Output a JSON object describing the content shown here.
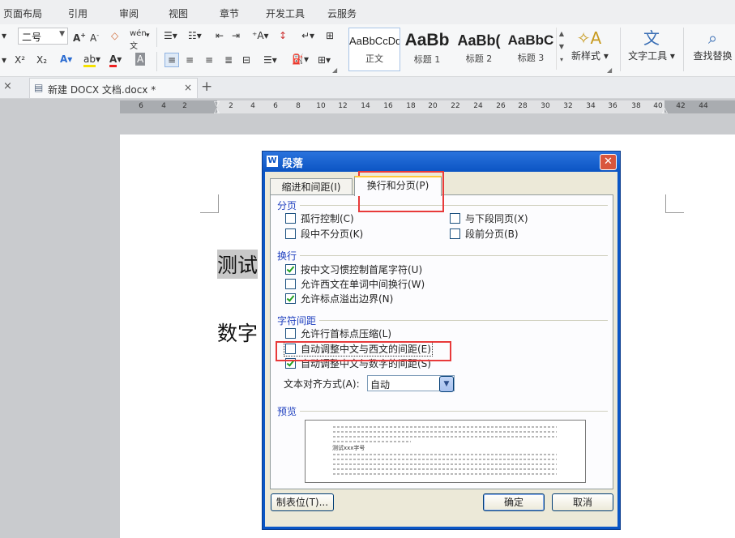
{
  "menubar": {
    "items": [
      "页面布局",
      "引用",
      "审阅",
      "视图",
      "章节",
      "开发工具",
      "云服务"
    ]
  },
  "toolbar": {
    "font_size": "二号",
    "styles": [
      {
        "preview": "AaBbCcDd",
        "name": "正文"
      },
      {
        "preview": "AaBb",
        "name": "标题 1"
      },
      {
        "preview": "AaBb(",
        "name": "标题 2"
      },
      {
        "preview": "AaBbC",
        "name": "标题 3"
      }
    ],
    "new_style_label": "新样式",
    "text_tools_label": "文字工具",
    "find_replace_label": "查找替换"
  },
  "tabbar": {
    "doc_tab_title": "新建 DOCX 文档.docx *",
    "close_symbol": "×",
    "add_symbol": "+"
  },
  "ruler": {
    "numbers": [
      "6",
      "4",
      "2",
      "2",
      "4",
      "6",
      "8",
      "10",
      "12",
      "14",
      "16",
      "18",
      "20",
      "22",
      "24",
      "26",
      "28",
      "30",
      "32",
      "34",
      "36",
      "38",
      "40",
      "42",
      "44"
    ]
  },
  "document": {
    "line1": "测试",
    "line2": "数字"
  },
  "dialog": {
    "title": "段落",
    "close_symbol": "✕",
    "tabs": [
      "缩进和间距(I)",
      "换行和分页(P)"
    ],
    "sections": {
      "pagination": "分页",
      "line_break": "换行",
      "char_spacing": "字符间距",
      "preview": "预览"
    },
    "pagination_options": [
      {
        "label": "孤行控制(C)",
        "checked": false
      },
      {
        "label": "与下段同页(X)",
        "checked": false
      },
      {
        "label": "段中不分页(K)",
        "checked": false
      },
      {
        "label": "段前分页(B)",
        "checked": false
      }
    ],
    "line_break_options": [
      {
        "label": "按中文习惯控制首尾字符(U)",
        "checked": true
      },
      {
        "label": "允许西文在单词中间换行(W)",
        "checked": false
      },
      {
        "label": "允许标点溢出边界(N)",
        "checked": true
      }
    ],
    "char_spacing_options": [
      {
        "label": "允许行首标点压缩(L)",
        "checked": false
      },
      {
        "label": "自动调整中文与西文的间距(E)",
        "checked": false
      },
      {
        "label": "自动调整中文与数字的间距(S)",
        "checked": true
      }
    ],
    "text_align_label": "文本对齐方式(A):",
    "text_align_value": "自动",
    "preview_sample": "测试xxx字号",
    "buttons": {
      "tabs": "制表位(T)...",
      "ok": "确定",
      "cancel": "取消"
    }
  },
  "colors": {
    "dialog_blue": "#0a56c6",
    "section_blue": "#1e3fbf",
    "highlight_red": "#e83a3a",
    "check_green": "#21a121"
  }
}
